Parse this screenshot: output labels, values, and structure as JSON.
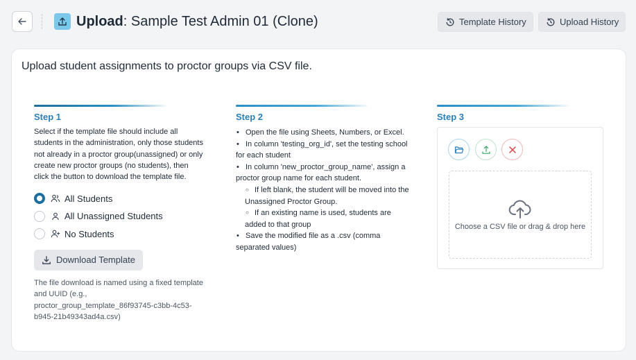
{
  "header": {
    "title_bold": "Upload",
    "title_rest": ": Sample Test Admin 01 (Clone)",
    "template_history_label": "Template History",
    "upload_history_label": "Upload History"
  },
  "main": {
    "lead": "Upload student assignments to proctor groups via CSV file.",
    "step1": {
      "title": "Step 1",
      "description": "Select if the template file should include all students in the administration, only those students not already in a proctor group(unassigned) or only create new proctor groups (no students), then click the button to download the template file.",
      "options": [
        {
          "label": "All Students",
          "checked": true
        },
        {
          "label": "All Unassigned Students",
          "checked": false
        },
        {
          "label": "No Students",
          "checked": false
        }
      ],
      "download_label": "Download Template",
      "note": "The file download is named using a fixed template and UUID (e.g., proctor_group_template_86f93745-c3bb-4c53-b945-21b49343ad4a.csv)"
    },
    "step2": {
      "title": "Step 2",
      "items": [
        "Open the file using Sheets, Numbers, or Excel.",
        "In column 'testing_org_id', set the testing school for each student",
        "In column 'new_proctor_group_name', assign a proctor group name for each student.",
        "If left blank, the student will be moved into the Unassigned Proctor Group.",
        "If an existing name is used, students are added to that group",
        "Save the modified file as a .csv (comma separated values)"
      ]
    },
    "step3": {
      "title": "Step 3",
      "drop_text": "Choose a CSV file or drag & drop here"
    }
  },
  "colors": {
    "accent": "#2b7fb5",
    "icon_bg": "#7cc7ea",
    "upload_green": "#3aa66b",
    "cancel_red": "#d64545"
  }
}
